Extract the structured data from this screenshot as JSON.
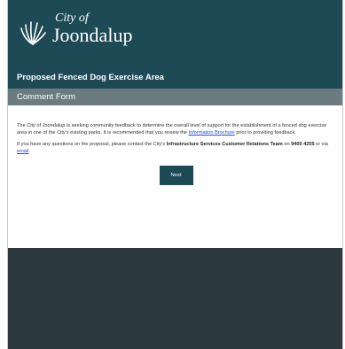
{
  "header": {
    "logo_line1": "City of",
    "logo_line2": "Joondalup"
  },
  "title_bar": "Proposed Fenced Dog Exercise Area",
  "section_bar": "Comment Form",
  "intro": {
    "text_before": "The City of Joondalup is seeking community feedback to determine the overall level of support for the establishment of a fenced dog exercise area in one of the City's existing parks. It is recommended that you review the ",
    "link": "Information Brochure",
    "text_after": " prior to providing feedback."
  },
  "contact": {
    "text_before": "If you have any questions on the proposal, please contact the City's ",
    "team": "Infrastructure Services Customer Relations Team",
    "text_on": " on ",
    "phone": "9400 4255",
    "text_or": " or via ",
    "email_link": "email",
    "text_end": "."
  },
  "next_button": "Next",
  "colors": {
    "header": "#1e4a56",
    "section": "#6b7c80",
    "footer": "#2c393e",
    "link": "#1a4fd6"
  }
}
